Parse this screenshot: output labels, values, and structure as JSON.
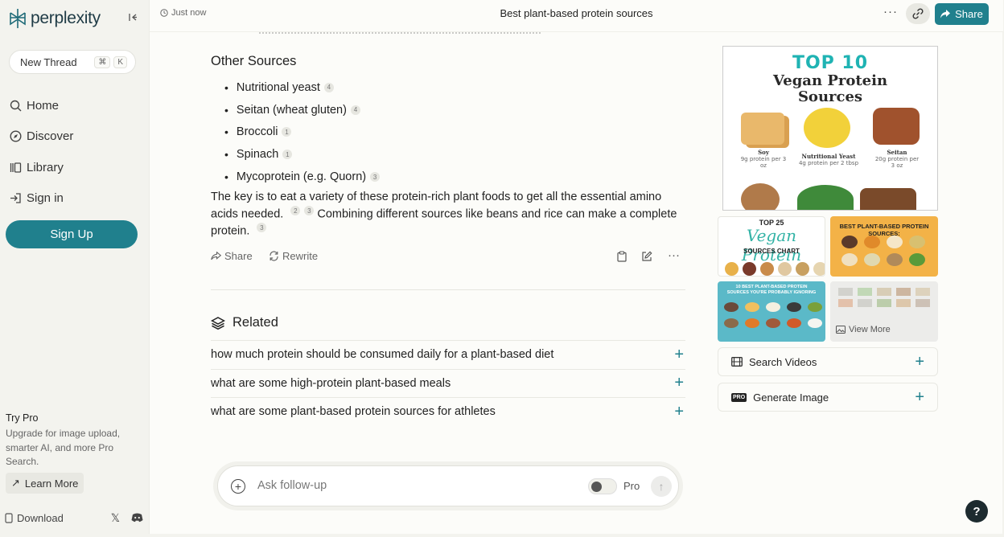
{
  "app": {
    "name": "perplexity"
  },
  "sidebar": {
    "new_thread": "New Thread",
    "shortcut_keys": [
      "⌘",
      "K"
    ],
    "items": [
      {
        "label": "Home",
        "icon": "search-icon"
      },
      {
        "label": "Discover",
        "icon": "compass-icon"
      },
      {
        "label": "Library",
        "icon": "library-icon"
      },
      {
        "label": "Sign in",
        "icon": "sign-in-icon"
      }
    ],
    "signup": "Sign Up",
    "try_pro": {
      "title": "Try Pro",
      "desc": "Upgrade for image upload, smarter AI, and more Pro Search.",
      "learn_more": "Learn More"
    },
    "download": "Download"
  },
  "header": {
    "timestamp": "Just now",
    "title": "Best plant-based protein sources",
    "share": "Share"
  },
  "answer": {
    "section_title": "Other Sources",
    "bullets": [
      {
        "text": "Nutritional yeast",
        "cite": "4"
      },
      {
        "text": "Seitan (wheat gluten)",
        "cite": "4"
      },
      {
        "text": "Broccoli",
        "cite": "1"
      },
      {
        "text": "Spinach",
        "cite": "1"
      },
      {
        "text": "Mycoprotein (e.g. Quorn)",
        "cite": "3"
      }
    ],
    "para_1": "The key is to eat a variety of these protein-rich plant foods to get all the essential amino acids needed.",
    "para_cites_1": [
      "2",
      "3"
    ],
    "para_2": "Combining different sources like beans and rice can make a complete protein.",
    "para_cite_2": "3",
    "actions": {
      "share": "Share",
      "rewrite": "Rewrite"
    }
  },
  "related": {
    "title": "Related",
    "items": [
      "how much protein should be consumed daily for a plant-based diet",
      "what are some high-protein plant-based meals",
      "what are some plant-based protein sources for athletes"
    ]
  },
  "ask": {
    "placeholder": "Ask follow-up",
    "pro_label": "Pro"
  },
  "images": {
    "main": {
      "headline": "TOP 10",
      "subtitle_1": "Vegan Protein",
      "subtitle_2": "Sources",
      "foods": [
        {
          "name": "Soy",
          "detail": "9g protein per 3 oz"
        },
        {
          "name": "Nutritional Yeast",
          "detail": "4g protein per 2 tbsp"
        },
        {
          "name": "Seitan",
          "detail": "20g protein per 3 oz"
        }
      ]
    },
    "thumb_1": {
      "line_1": "TOP 25",
      "line_2": "Vegan Protein",
      "line_3": "SOURCES CHART"
    },
    "thumb_2": {
      "line_1": "BEST PLANT-BASED PROTEIN SOURCES:"
    },
    "thumb_3": {
      "line_1": "10 BEST PLANT-BASED PROTEIN SOURCES YOU'RE PROBABLY IGNORING"
    },
    "view_more": "View More"
  },
  "right_actions": {
    "search_videos": "Search Videos",
    "generate_image": "Generate Image"
  },
  "colors": {
    "accent": "#20808d",
    "sidebar_bg": "#f3f3ee",
    "main_bg": "#fcfcf9"
  }
}
